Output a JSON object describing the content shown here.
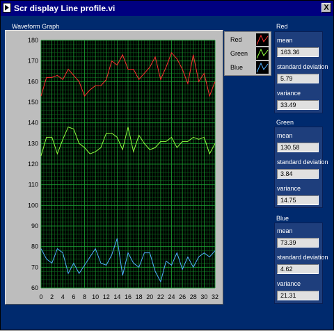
{
  "window": {
    "title": "Scr display Line profile.vi",
    "close_label": "X"
  },
  "graph": {
    "label": "Waveform Graph"
  },
  "legend": [
    {
      "name": "Red",
      "color": "#ff3030"
    },
    {
      "name": "Green",
      "color": "#90ff40"
    },
    {
      "name": "Blue",
      "color": "#50b0ff"
    }
  ],
  "stats": {
    "red": {
      "title": "Red",
      "mean_label": "mean",
      "mean": "163.36",
      "sd_label": "standard deviation",
      "sd": "5.79",
      "var_label": "variance",
      "variance": "33.49"
    },
    "green": {
      "title": "Green",
      "mean_label": "mean",
      "mean": "130.58",
      "sd_label": "standard deviation",
      "sd": "3.84",
      "var_label": "variance",
      "variance": "14.75"
    },
    "blue": {
      "title": "Blue",
      "mean_label": "mean",
      "mean": "73.39",
      "sd_label": "standard deviation",
      "sd": "4.62",
      "var_label": "variance",
      "variance": "21.31"
    }
  },
  "chart_data": {
    "type": "line",
    "x": [
      0,
      1,
      2,
      3,
      4,
      5,
      6,
      7,
      8,
      9,
      10,
      11,
      12,
      13,
      14,
      15,
      16,
      17,
      18,
      19,
      20,
      21,
      22,
      23,
      24,
      25,
      26,
      27,
      28,
      29,
      30,
      31,
      32
    ],
    "xticks": [
      0,
      2,
      4,
      6,
      8,
      10,
      12,
      14,
      16,
      18,
      20,
      22,
      24,
      26,
      28,
      30,
      32
    ],
    "yticks": [
      60,
      70,
      80,
      90,
      100,
      110,
      120,
      130,
      140,
      150,
      160,
      170,
      180
    ],
    "xlim": [
      0,
      32
    ],
    "ylim": [
      60,
      180
    ],
    "grid": true,
    "legend_position": "top-right",
    "series": [
      {
        "name": "Red",
        "color": "#ff3030",
        "values": [
          153,
          162,
          162,
          163,
          161,
          166,
          163,
          160,
          153,
          156,
          158,
          158,
          161,
          170,
          168,
          173,
          166,
          166,
          161,
          164,
          167,
          172,
          161,
          167,
          174,
          171,
          166,
          159,
          173,
          160,
          164,
          153,
          160
        ]
      },
      {
        "name": "Green",
        "color": "#90ff40",
        "values": [
          124,
          133,
          133,
          125,
          132,
          138,
          137,
          130,
          128,
          125,
          126,
          128,
          135,
          135,
          133,
          127,
          138,
          126,
          134,
          130,
          127,
          128,
          131,
          131,
          133,
          128,
          131,
          131,
          133,
          132,
          133,
          125,
          130
        ]
      },
      {
        "name": "Blue",
        "color": "#50b0ff",
        "values": [
          79,
          74,
          72,
          79,
          77,
          67,
          72,
          67,
          71,
          75,
          79,
          72,
          71,
          76,
          84,
          66,
          77,
          72,
          70,
          77,
          77,
          68,
          63,
          73,
          71,
          77,
          69,
          75,
          70,
          75,
          77,
          75,
          78
        ]
      }
    ]
  }
}
